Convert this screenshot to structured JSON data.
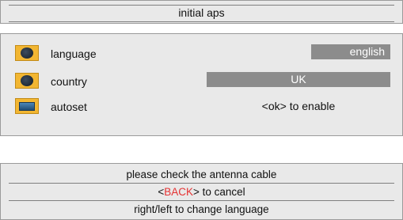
{
  "title": "initial aps",
  "settings": {
    "language": {
      "label": "language",
      "value": "english",
      "icon": "globe-icon"
    },
    "country": {
      "label": "country",
      "value": "UK",
      "icon": "globe-icon"
    },
    "autoset": {
      "label": "autoset",
      "value": "<ok> to enable",
      "icon": "tv-icon"
    }
  },
  "messages": {
    "line1": "please check the antenna cable",
    "line2_prefix": "<",
    "line2_key": "BACK",
    "line2_suffix": "> to cancel",
    "line3": "right/left to change language"
  },
  "colors": {
    "panel": "#e9e9e9",
    "value_box": "#8c8c8c",
    "icon_bg": "#f2b632",
    "back_key": "#e53232"
  }
}
